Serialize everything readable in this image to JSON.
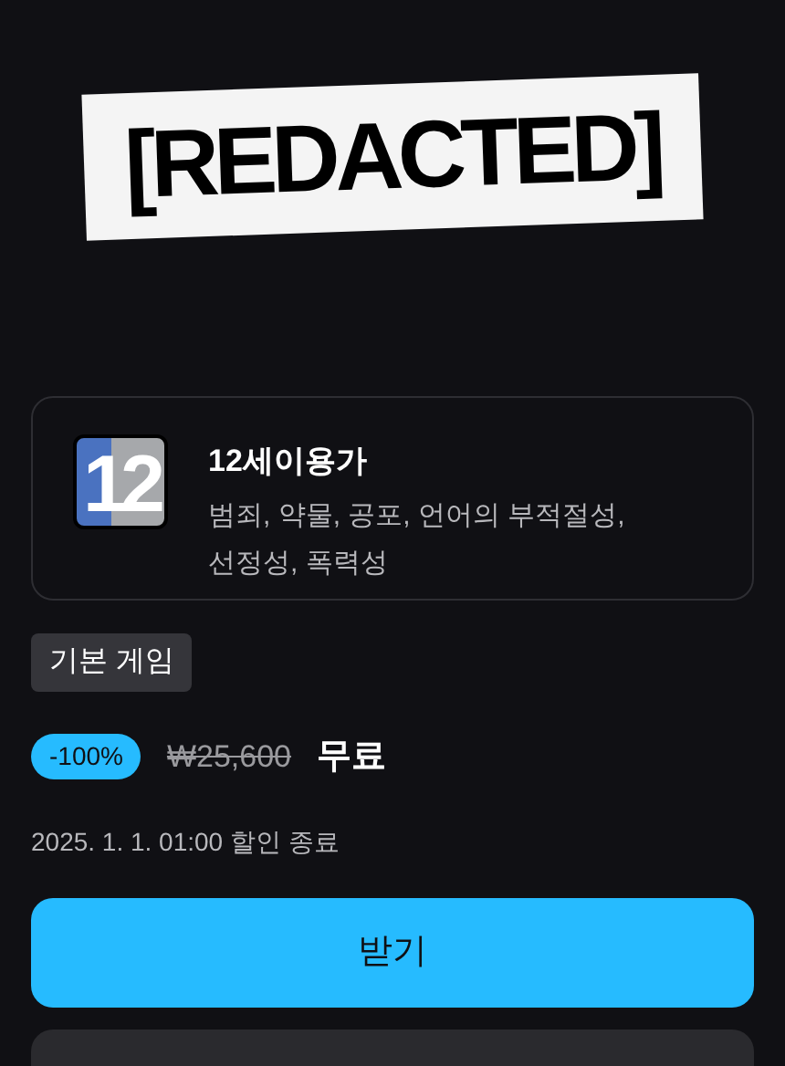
{
  "logo": {
    "text": "[REDACTED]"
  },
  "rating": {
    "badge": "12",
    "title": "12세이용가",
    "descriptors": "범죄, 약물, 공포, 언어의 부적절성, 선정성, 폭력성"
  },
  "edition_tag": "기본 게임",
  "price": {
    "discount": "-100%",
    "original": "₩25,600",
    "current": "무료"
  },
  "sale_end": "2025. 1. 1. 01:00 할인 종료",
  "buttons": [
    {
      "label": "받기",
      "kind": "primary"
    }
  ]
}
